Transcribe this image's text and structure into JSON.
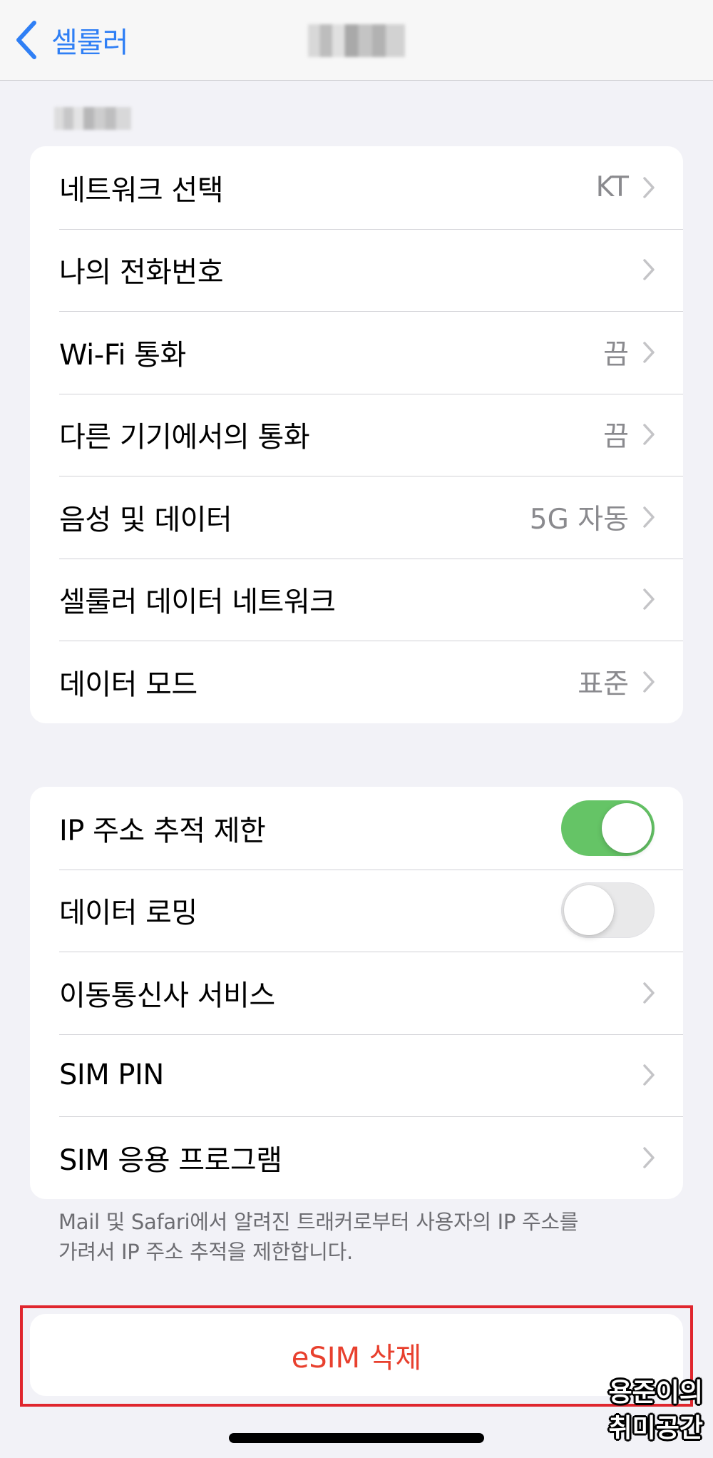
{
  "navbar": {
    "back_label": "셀룰러"
  },
  "colors": {
    "accent": "#2f7ff5",
    "toggle_on": "#65c466",
    "toggle_off": "#e9e9ea",
    "destructive": "#e8402e",
    "highlight": "#e0262e"
  },
  "group1": [
    {
      "label": "네트워크 선택",
      "value": "KT"
    },
    {
      "label": "나의 전화번호",
      "value": ""
    },
    {
      "label": "Wi-Fi 통화",
      "value": "끔"
    },
    {
      "label": "다른 기기에서의 통화",
      "value": "끔"
    },
    {
      "label": "음성 및 데이터",
      "value": "5G 자동"
    },
    {
      "label": "셀룰러 데이터 네트워크",
      "value": ""
    },
    {
      "label": "데이터 모드",
      "value": "표준"
    }
  ],
  "group2": [
    {
      "label": "IP 주소 추적 제한",
      "toggle": true
    },
    {
      "label": "데이터 로밍",
      "toggle": false
    },
    {
      "label": "이동통신사 서비스"
    },
    {
      "label": "SIM PIN"
    },
    {
      "label": "SIM 응용 프로그램"
    }
  ],
  "footer_line1": "Mail 및 Safari에서 알려진 트래커로부터 사용자의 IP 주소를",
  "footer_line2": "가려서 IP 주소 추적을 제한합니다.",
  "esim_delete_label": "eSIM 삭제",
  "watermark": {
    "line1": "용준이의",
    "line2": "취미공간"
  }
}
